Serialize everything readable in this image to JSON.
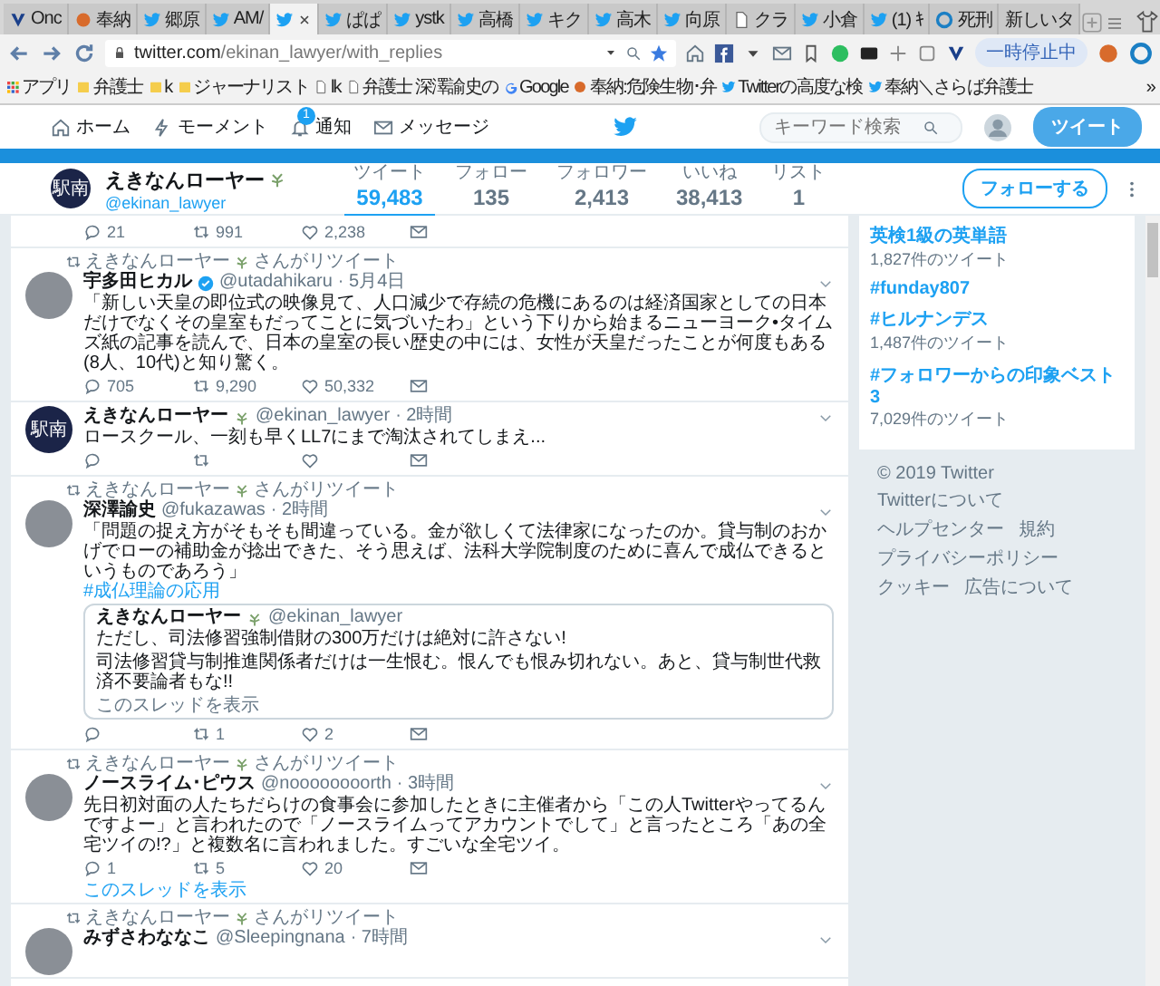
{
  "browser": {
    "tabs": [
      {
        "label": "Onc",
        "kind": "v",
        "selected": false
      },
      {
        "label": "奉納",
        "kind": "fire",
        "selected": false
      },
      {
        "label": "郷原",
        "kind": "twitter",
        "selected": false
      },
      {
        "label": "AM/",
        "kind": "twitter",
        "selected": false
      },
      {
        "kind": "twitter",
        "selected": true
      },
      {
        "label": "ぱぱ",
        "kind": "twitter",
        "selected": false
      },
      {
        "label": "ystk",
        "kind": "twitter",
        "selected": false
      },
      {
        "label": "高橋",
        "kind": "twitter",
        "selected": false
      },
      {
        "label": "キク",
        "kind": "twitter",
        "selected": false
      },
      {
        "label": "高木",
        "kind": "twitter",
        "selected": false
      },
      {
        "label": "向原",
        "kind": "twitter",
        "selected": false
      },
      {
        "label": "クラ",
        "kind": "page",
        "selected": false
      },
      {
        "label": "小倉",
        "kind": "twitter",
        "selected": false
      },
      {
        "label": "(1) ｷ",
        "kind": "twitter",
        "selected": false
      },
      {
        "label": "死刑",
        "kind": "sync",
        "selected": false
      },
      {
        "label": "新しいタ",
        "kind": "blank",
        "selected": false
      }
    ],
    "url_host": "twitter.com",
    "url_path": "/ekinan_lawyer/with_replies",
    "pause_label": "一時停止中",
    "bookmarks": [
      {
        "label": "アプリ",
        "kind": "apps"
      },
      {
        "label": "弁護士",
        "kind": "folder"
      },
      {
        "label": "k",
        "kind": "folder"
      },
      {
        "label": "ジャーナリスト",
        "kind": "folder"
      },
      {
        "label": "lk",
        "kind": "page"
      },
      {
        "label": "弁護士 深澤諭史の",
        "kind": "page"
      },
      {
        "label": "Google",
        "kind": "google"
      },
      {
        "label": "奉納:危険生物･弁",
        "kind": "other"
      },
      {
        "label": "Twitterの高度な検",
        "kind": "twitter"
      },
      {
        "label": "奉納＼さらば弁護士",
        "kind": "twitter"
      }
    ],
    "more": "»"
  },
  "twitter_nav": {
    "items": [
      {
        "label": "ホーム",
        "kind": "home"
      },
      {
        "label": "モーメント",
        "kind": "moments"
      },
      {
        "label": "通知",
        "kind": "notifications",
        "badge": "1"
      },
      {
        "label": "メッセージ",
        "kind": "messages"
      }
    ],
    "search": {
      "placeholder": "キーワード検索"
    },
    "tweet_button": "ツイート"
  },
  "profile": {
    "name": "えきなんローヤー",
    "handle": "@ekinan_lawyer",
    "avatar_text": "駅南",
    "stats": [
      {
        "label": "ツイート",
        "value": "59,483",
        "selected": true
      },
      {
        "label": "フォロー",
        "value": "135",
        "selected": false
      },
      {
        "label": "フォロワー",
        "value": "2,413",
        "selected": false
      },
      {
        "label": "いいね",
        "value": "38,413",
        "selected": false
      },
      {
        "label": "リスト",
        "value": "1",
        "selected": false
      }
    ],
    "follow_button": "フォローする"
  },
  "tweets": [
    {
      "kind": "partial",
      "actions": {
        "reply": "21",
        "retweet": "991",
        "like": "2,238"
      }
    },
    {
      "kind": "tweet",
      "retweeter": "えきなんローヤー",
      "retweet_note": "さんがリツイート",
      "avatar": {
        "kind": "photo"
      },
      "name": "宇多田ヒカル",
      "verified": true,
      "handle": "@utadahikaru",
      "time": "· 5月4日",
      "text": "「新しい天皇の即位式の映像見て、人口減少で存続の危機にあるのは経済国家としての日本だけでなくその皇室もだってことに気づいたわ」という下りから始まるニューヨーク•タイムズ紙の記事を読んで、日本の皇室の長い歴史の中には、女性が天皇だったことが何度もある(8人、10代)と知り驚く。",
      "actions": {
        "reply": "705",
        "retweet": "9,290",
        "like": "50,332"
      }
    },
    {
      "kind": "tweet",
      "avatar": {
        "kind": "logo",
        "text": "駅南"
      },
      "name": "えきなんローヤー",
      "verified": false,
      "handle": "@ekinan_lawyer",
      "time": "· 2時間",
      "text": "ロースクール、一刻も早くLL7にまで淘汰されてしまえ..."
    },
    {
      "kind": "tweet",
      "retweeter": "えきなんローヤー",
      "retweet_note": "さんがリツイート",
      "avatar": {
        "kind": "photo"
      },
      "name": "深澤諭史",
      "verified": false,
      "handle": "@fukazawas",
      "time": "· 2時間",
      "text": "「問題の捉え方がそもそも間違っている。金が欲しくて法律家になったのか。貸与制のおかげでローの補助金が捻出できた、そう思えば、法科大学院制度のために喜んで成仏できるというものであろう」",
      "hashtag": "#成仏理論の応用",
      "quote": {
        "name": "えきなんローヤー",
        "handle": "@ekinan_lawyer",
        "paragraphs": [
          "ただし、司法修習強制借財の300万だけは絶対に許さない!",
          "司法修習貸与制推進関係者だけは一生恨む。恨んでも恨み切れない。あと、貸与制世代救済不要論者もな!!"
        ],
        "link": "このスレッドを表示"
      },
      "actions": {
        "retweet": "1",
        "like": "2"
      }
    },
    {
      "kind": "tweet",
      "retweeter": "えきなんローヤー",
      "retweet_note": "さんがリツイート",
      "avatar": {
        "kind": "photo"
      },
      "name": "ノースライム･ピウス",
      "verified": false,
      "handle": "@noooooooorth",
      "time": "· 3時間",
      "text": "先日初対面の人たちだらけの食事会に参加したときに主催者から「この人Twitterやってるんですよー」と言われたので「ノースライムってアカウントでして」と言ったところ「あの全宅ツイの!?」と複数名に言われました。すごいな全宅ツイ。",
      "actions": {
        "reply": "1",
        "retweet": "5",
        "like": "20"
      },
      "thread_link": "このスレッドを表示"
    },
    {
      "kind": "tweet",
      "retweeter": "えきなんローヤー",
      "retweet_note": "さんがリツイート",
      "avatar": {
        "kind": "photo"
      },
      "name": "みずさわななこ",
      "verified": false,
      "handle": "@Sleepingnana",
      "time": "· 7時間"
    }
  ],
  "sidebar": {
    "trends": [
      {
        "name": "英検1級の英単語",
        "count": "1,827件のツイート"
      },
      {
        "name": "#funday807"
      },
      {
        "name": "#ヒルナンデス",
        "count": "1,487件のツイート"
      },
      {
        "name": "#フォロワーからの印象ベスト3",
        "count": "7,029件のツイート"
      }
    ],
    "footer": [
      "© 2019 Twitter",
      "Twitterについて",
      "ヘルプセンター",
      "規約",
      "プライバシーポリシー",
      "クッキー",
      "広告について"
    ]
  }
}
